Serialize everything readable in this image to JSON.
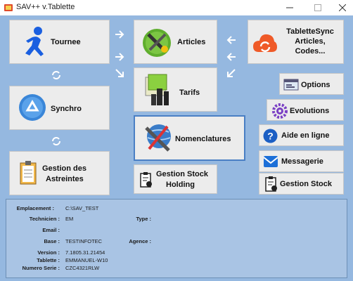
{
  "window": {
    "title": "SAV++ v.Tablette"
  },
  "buttons": {
    "tournee": "Tournee",
    "articles": "Articles",
    "tablettesync": [
      "TabletteSync",
      "Articles,",
      "Codes..."
    ],
    "tarifs": "Tarifs",
    "synchro": "Synchro",
    "nomenclatures": "Nomenclatures",
    "astreintes": [
      "Gestion des",
      "Astreintes"
    ],
    "stock_holding": [
      "Gestion Stock",
      "Holding"
    ],
    "options": "Options",
    "evolutions": "Evolutions",
    "aide": "Aide en ligne",
    "messagerie": "Messagerie",
    "gestion_stock": "Gestion Stock"
  },
  "info": {
    "emplacement": {
      "label": "Emplacement :",
      "value": "C:\\SAV_TEST"
    },
    "technicien": {
      "label": "Technicien :",
      "value": "EM"
    },
    "type": {
      "label": "Type :",
      "value": ""
    },
    "email": {
      "label": "Email :",
      "value": ""
    },
    "base": {
      "label": "Base :",
      "value": "TESTINFOTEC"
    },
    "agence": {
      "label": "Agence :",
      "value": ""
    },
    "version": {
      "label": "Version :",
      "value": "7.1805.31.21454"
    },
    "tablette": {
      "label": "Tablette :",
      "value": "EMMANUEL-W10"
    },
    "numero_serie": {
      "label": "Numero Serie :",
      "value": "CZC4321RLW"
    }
  },
  "colors": {
    "background": "#95b8e0",
    "info_panel": "#a9c4e4",
    "button_face": "#ececec",
    "selected_border": "#4a7fc4"
  }
}
